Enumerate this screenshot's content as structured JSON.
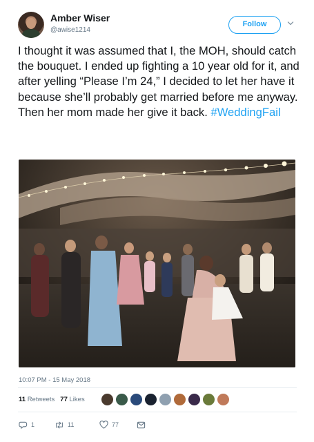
{
  "tweet": {
    "author_name": "Amber Wiser",
    "author_handle": "@awise1214",
    "follow_label": "Follow",
    "text_main": "I thought it was assumed that I, the MOH, should catch the bouquet. I ended up fighting a 10 year old for it, and after yelling “Please I’m 24,” I decided to let her have it because she’ll probably get married before me anyway. Then her mom made her give it back.",
    "hashtag": "#WeddingFail",
    "timestamp": "10:07 PM - 15 May 2018"
  },
  "stats": {
    "retweets_count": "11",
    "retweets_label": "Retweets",
    "likes_count": "77",
    "likes_label": "Likes"
  },
  "actions": {
    "reply_count": "1",
    "retweet_count": "11",
    "like_count": "77"
  },
  "colors": {
    "accent": "#1da1f2",
    "text": "#14171a",
    "secondary": "#657786"
  },
  "icons": [
    "chevron-down-icon",
    "reply-icon",
    "retweet-icon",
    "heart-icon",
    "direct-message-icon"
  ]
}
